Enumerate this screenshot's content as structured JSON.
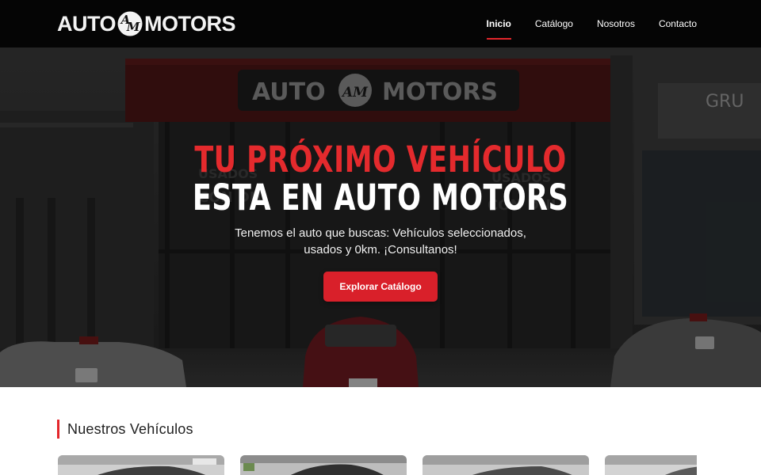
{
  "brand": {
    "left_word": "AUTO",
    "right_word": "MOTORS",
    "monogram": "AM",
    "accent": "#e3262b"
  },
  "nav": {
    "items": [
      {
        "label": "Inicio",
        "active": true
      },
      {
        "label": "Catálogo",
        "active": false
      },
      {
        "label": "Nosotros",
        "active": false
      },
      {
        "label": "Contacto",
        "active": false
      }
    ]
  },
  "hero": {
    "title_line1": "TU PRÓXIMO VEHÍCULO",
    "title_line2": "ESTA EN AUTO MOTORS",
    "subtitle": "Tenemos el auto que buscas: Vehículos seleccionados, usados y 0km. ¡Consultanos!",
    "cta_label": "Explorar Catálogo",
    "background_image": "dealership-storefront-photo"
  },
  "section": {
    "title": "Nuestros Vehículos",
    "cards": [
      {
        "image": "vehicle-photo-1"
      },
      {
        "image": "vehicle-photo-2"
      },
      {
        "image": "vehicle-photo-3"
      },
      {
        "image": "vehicle-photo-4"
      }
    ]
  }
}
